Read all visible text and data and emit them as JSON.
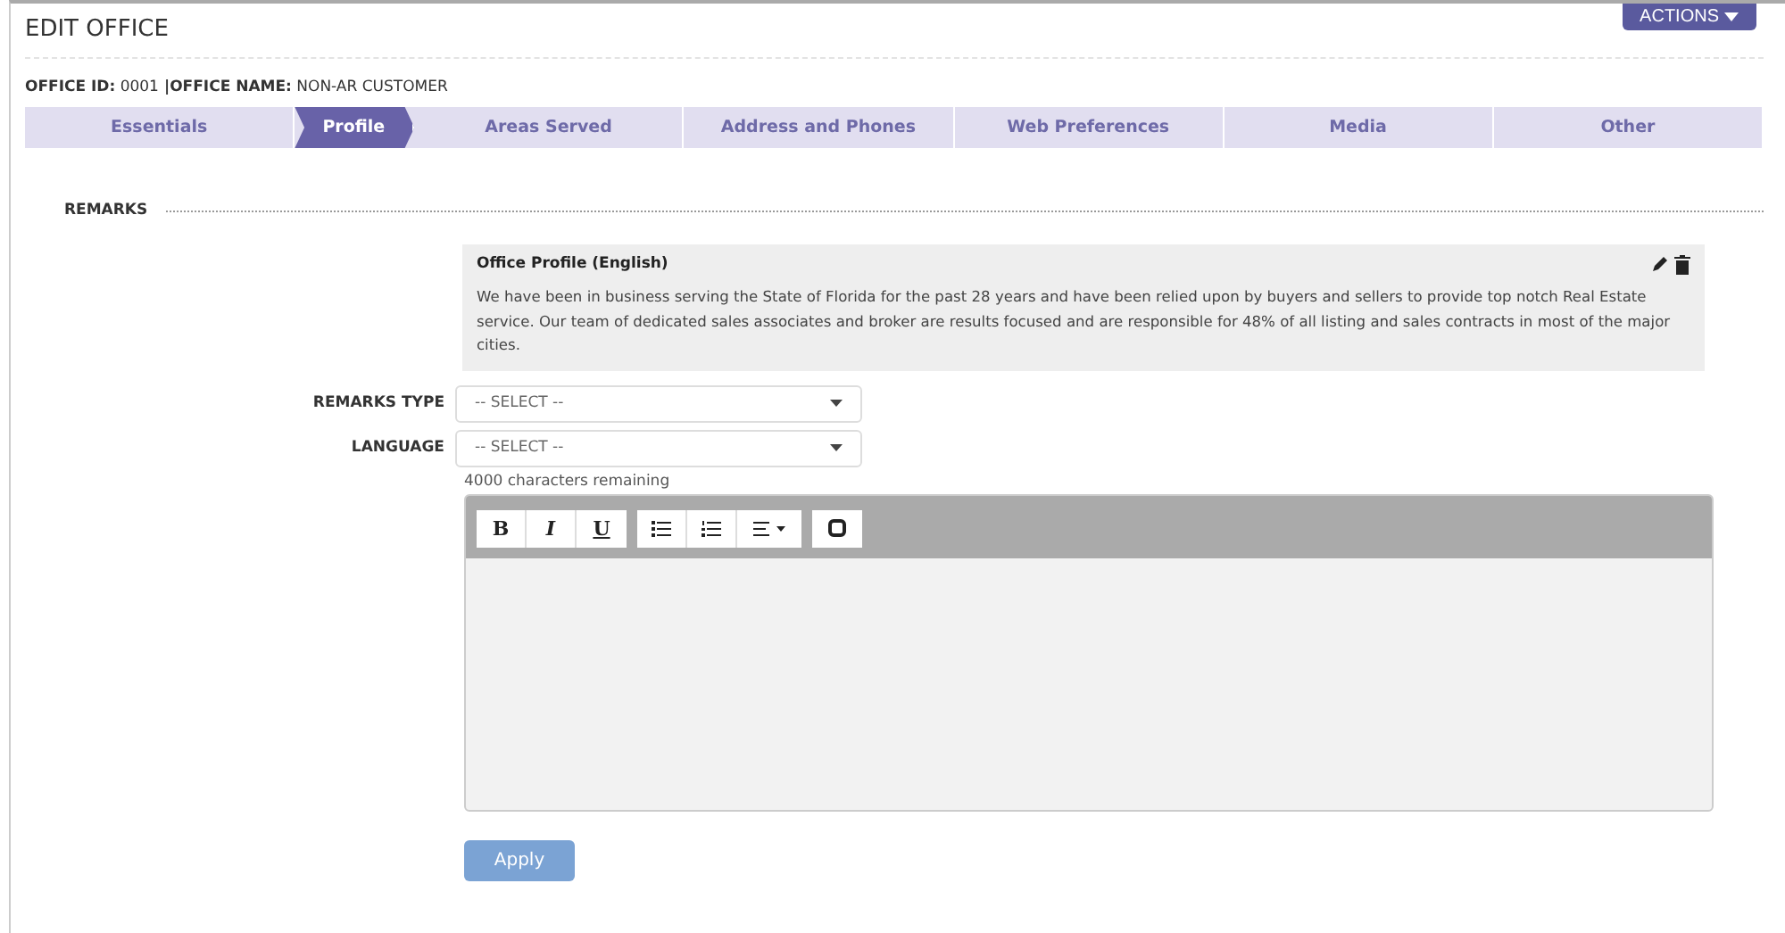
{
  "header": {
    "title": "EDIT OFFICE",
    "actions_button": "ACTIONS"
  },
  "office_info": [
    {
      "label": "OFFICE ID:",
      "value": "0001"
    },
    {
      "label": "|OFFICE NAME:",
      "value": "NON-AR CUSTOMER"
    }
  ],
  "steps": [
    {
      "label": "Essentials",
      "selected": false
    },
    {
      "label": "Profile",
      "selected": true
    },
    {
      "label": "Areas Served",
      "selected": false
    },
    {
      "label": "Address and Phones",
      "selected": false
    },
    {
      "label": "Web Preferences",
      "selected": false
    },
    {
      "label": "Media",
      "selected": false
    },
    {
      "label": "Other",
      "selected": false
    }
  ],
  "section_title": "REMARKS",
  "remark_card": {
    "title": "Office Profile (English)",
    "text": "We have been in business serving the State of Florida for the past 28 years and have been relied upon by buyers and sellers to provide top notch Real Estate service.  Our team of dedicated sales associates and broker are results focused and are responsible for 48% of all listing and sales contracts in most of the major cities."
  },
  "fields": [
    {
      "label": "REMARKS TYPE",
      "value": "-- SELECT --"
    },
    {
      "label": "LANGUAGE",
      "value": "-- SELECT --"
    }
  ],
  "char_count": "4000 characters remaining",
  "toolbar": [
    [
      {
        "kind": "text",
        "label": "B"
      },
      {
        "kind": "text",
        "label": "I"
      },
      {
        "kind": "text",
        "label": "U"
      }
    ],
    [
      {
        "kind": "bullets"
      },
      {
        "kind": "numbers"
      },
      {
        "kind": "align"
      }
    ],
    [
      {
        "kind": "source"
      }
    ]
  ],
  "apply_button": "Apply"
}
